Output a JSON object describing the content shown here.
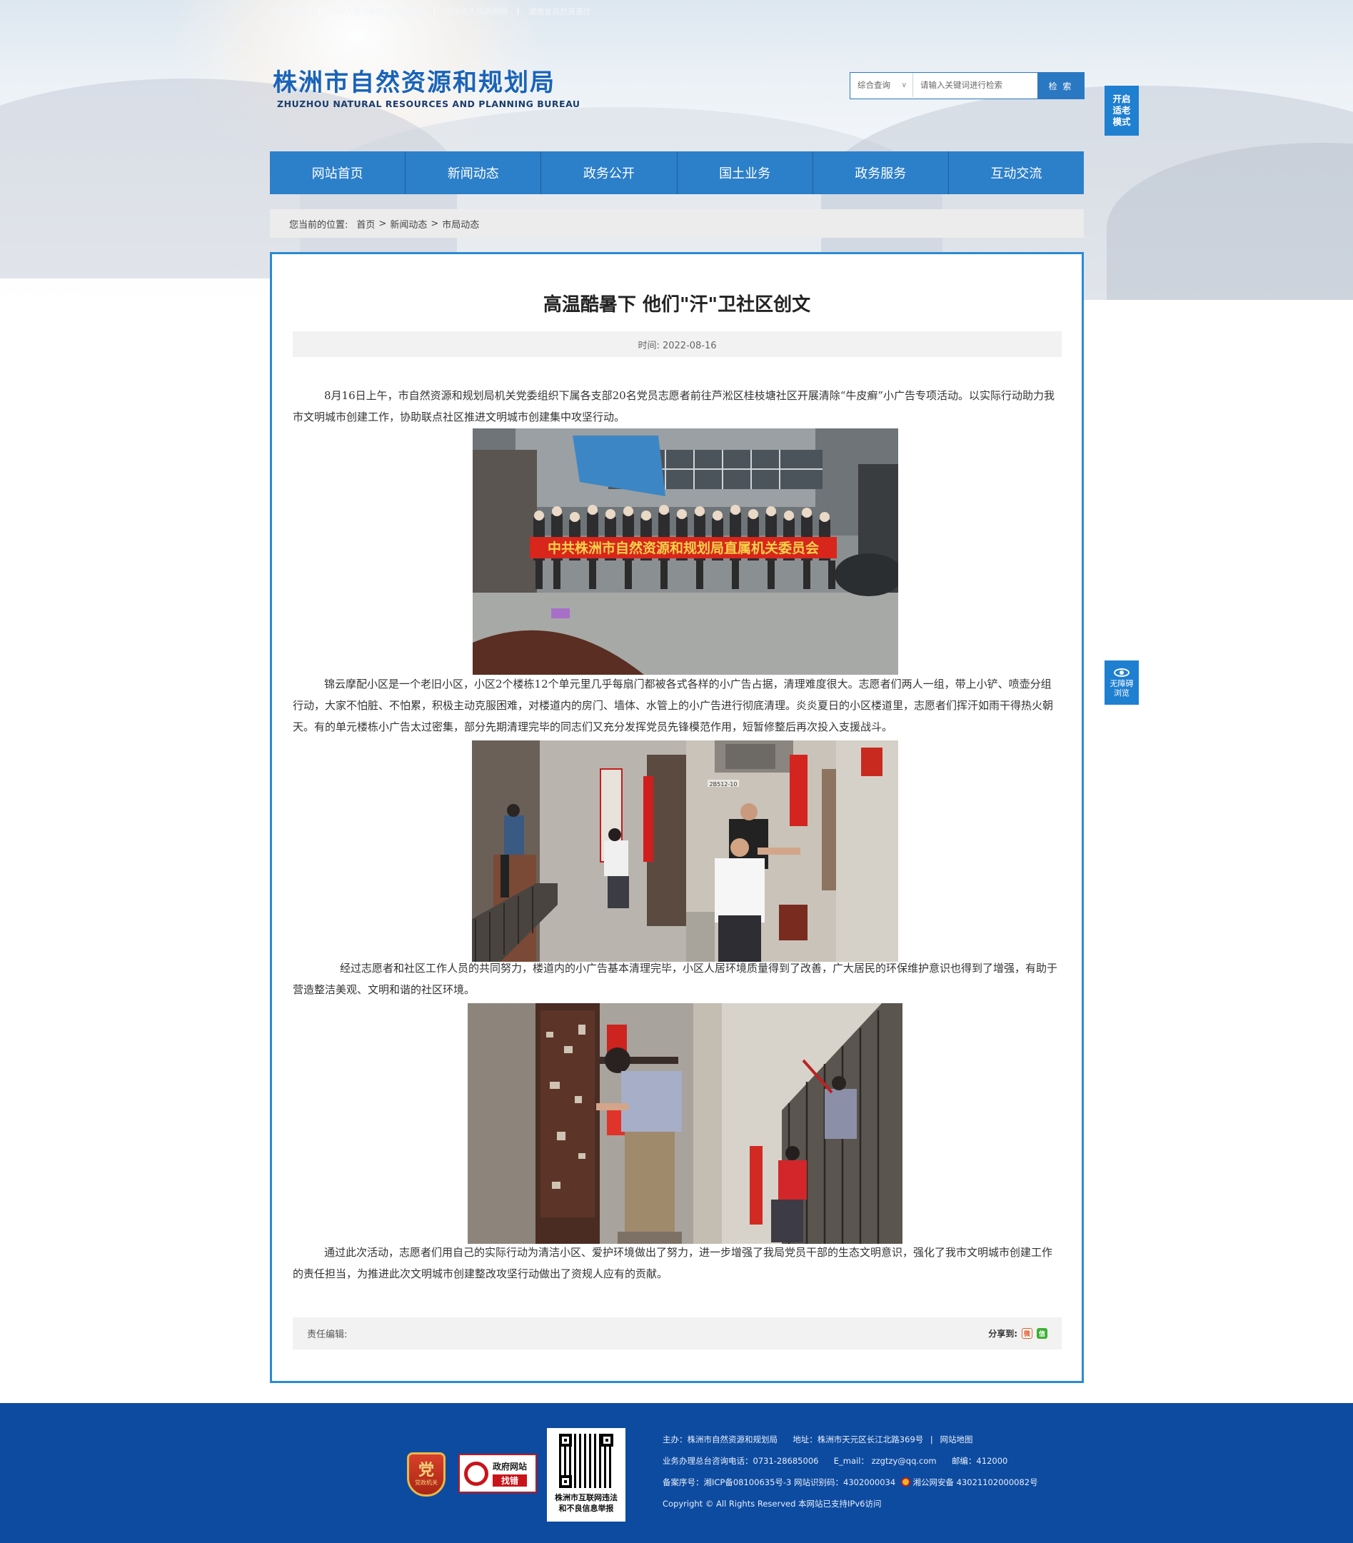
{
  "top_links": [
    "中国政府网",
    "中华人民共和国自然资源部",
    "湖南省人民政府网",
    "湖南省自然资源厅"
  ],
  "logo": {
    "cn": "株洲市自然资源和规划局",
    "en": "ZHUZHOU NATURAL RESOURCES AND PLANNING BUREAU"
  },
  "search": {
    "scope": "综合查询",
    "placeholder": "请输入关键词进行检索",
    "button": "检 索"
  },
  "side": {
    "elder_mode": [
      "开启",
      "适老",
      "模式"
    ],
    "accessible": [
      "无障碍",
      "浏览"
    ]
  },
  "nav": [
    "网站首页",
    "新闻动态",
    "政务公开",
    "国土业务",
    "政务服务",
    "互动交流"
  ],
  "breadcrumb": {
    "prefix": "您当前的位置:",
    "items": [
      "首页",
      "新闻动态",
      "市局动态"
    ]
  },
  "article": {
    "title": "高温酷暑下 他们\"汗\"卫社区创文",
    "time": "时间:  2022-08-16",
    "paragraphs": [
      "8月16日上午，市自然资源和规划局机关党委组织下属各支部20名党员志愿者前往芦淞区桂枝塘社区开展清除“牛皮癣”小广告专项活动。以实际行动助力我市文明城市创建工作，协助联点社区推进文明城市创建集中攻坚行动。",
      "锦云摩配小区是一个老旧小区，小区2个楼栋12个单元里几乎每扇门都被各式各样的小广告占据，清理难度很大。志愿者们两人一组，带上小铲、喷壶分组行动，大家不怕脏、不怕累，积极主动克服困难，对楼道内的房门、墙体、水管上的小广告进行彻底清理。炎炎夏日的小区楼道里，志愿者们挥汗如雨干得热火朝天。有的单元楼栋小广告太过密集，部分先期清理完毕的同志们又充分发挥党员先锋模范作用，短暂修整后再次投入支援战斗。",
      "经过志愿者和社区工作人员的共同努力，楼道内的小广告基本清理完毕，小区人居环境质量得到了改善，广大居民的环保维护意识也得到了增强，有助于营造整洁美观、文明和谐的社区环境。",
      "通过此次活动，志愿者们用自己的实际行动为清洁小区、爱护环境做出了努力，进一步增强了我局党员干部的生态文明意识，强化了我市文明城市创建工作的责任担当，为推进此次文明城市创建整改攻坚行动做出了资规人应有的贡献。"
    ],
    "photo1_banner": "中共株洲市自然资源和规划局直属机关委员会",
    "photo2_sign": "2B512-10",
    "editor_label": "责任编辑:",
    "share_label": "分享到:"
  },
  "footer": {
    "badge1_char": "党",
    "badge1_text": "党政机关",
    "badge2_line1": "政府网站",
    "badge2_line2": "找错",
    "qr_caption": [
      "株洲市互联网违法",
      "和不良信息举报"
    ],
    "host": "主办：株洲市自然资源和规划局",
    "address": "地址：株洲市天元区长江北路369号",
    "sitemap": "网站地图",
    "phone": "业务办理总台咨询电话：0731-28685006",
    "email": "E_mail： zzgtzy@qq.com",
    "postcode": "邮编：412000",
    "icp": "备案序号：湘ICP备08100635号-3 网站识别码：4302000034",
    "police": "湘公网安备 43021102000082号",
    "copyright": "Copyright © All Rights Reserved 本网站已支持IPv6访问"
  }
}
